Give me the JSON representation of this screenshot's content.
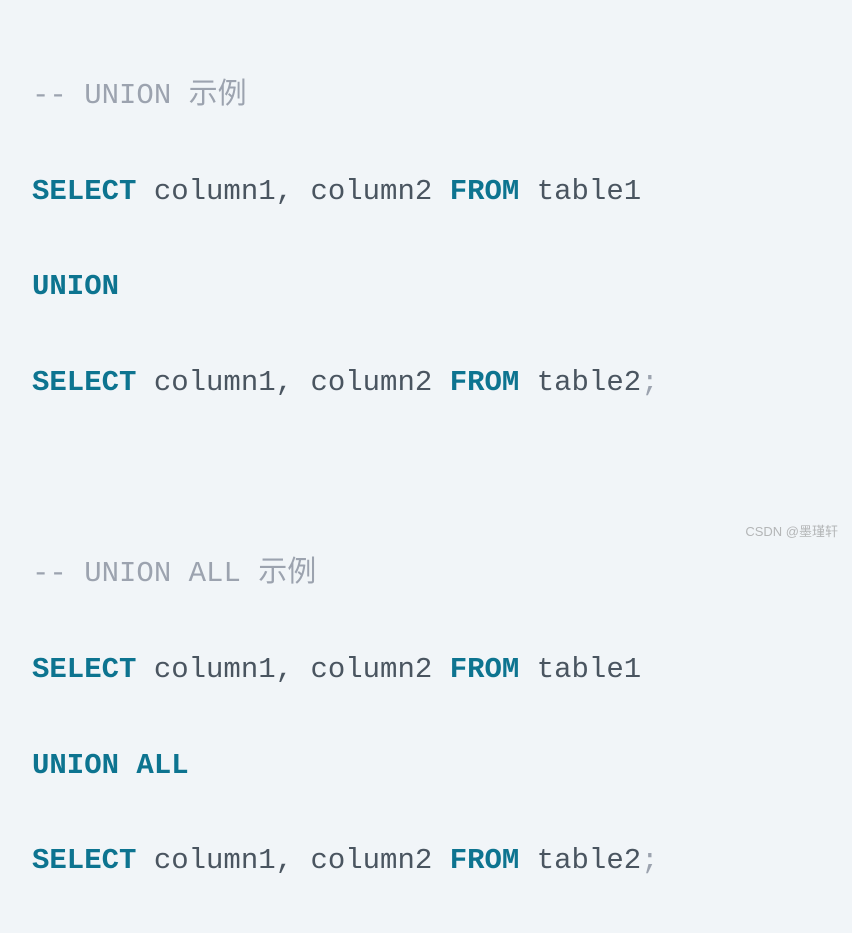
{
  "code": {
    "line1": {
      "comment_prefix": "-- ",
      "comment_text": "UNION 示例"
    },
    "line2": {
      "select": "SELECT",
      "cols": " column1, column2 ",
      "from": "FROM",
      "table": " table1"
    },
    "line3": {
      "union": "UNION"
    },
    "line4": {
      "select": "SELECT",
      "cols": " column1, column2 ",
      "from": "FROM",
      "table": " table2",
      "semi": ";"
    },
    "line5": {
      "blank": " "
    },
    "line6": {
      "comment_prefix": "-- ",
      "comment_text": "UNION ALL 示例"
    },
    "line7": {
      "select": "SELECT",
      "cols": " column1, column2 ",
      "from": "FROM",
      "table": " table1"
    },
    "line8": {
      "union_all": "UNION ALL"
    },
    "line9": {
      "select": "SELECT",
      "cols": " column1, column2 ",
      "from": "FROM",
      "table": " table2",
      "semi": ";"
    }
  },
  "watermark": "CSDN @墨瑾轩"
}
